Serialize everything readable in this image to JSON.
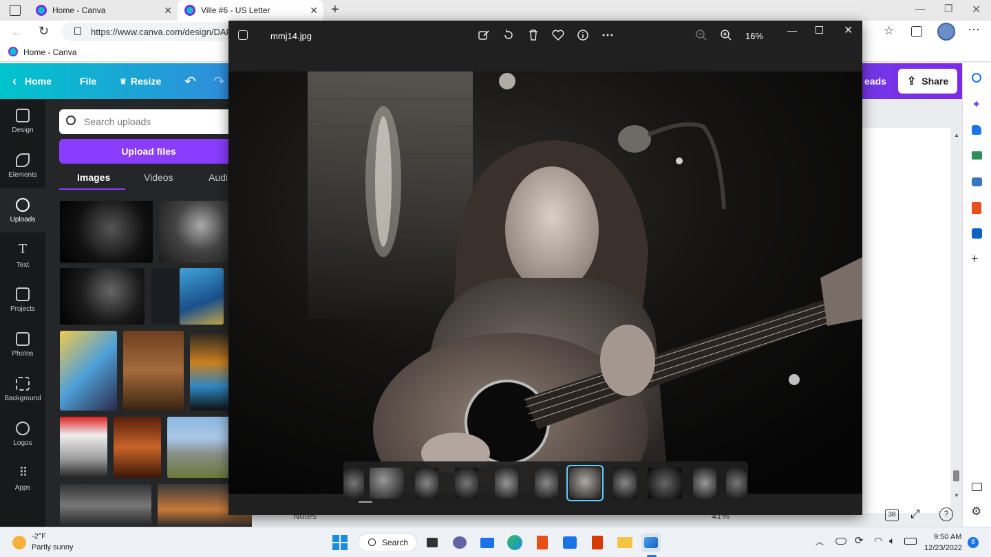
{
  "browser": {
    "tabs": [
      {
        "title": "Home - Canva"
      },
      {
        "title": "Ville #6 - US Letter"
      }
    ],
    "address": "https://www.canva.com/design/DAF",
    "favorites": [
      {
        "label": "Home - Canva"
      }
    ]
  },
  "canva": {
    "header": {
      "home": "Home",
      "file": "File",
      "resize": "Resize",
      "uploads_partial": "eads",
      "share": "Share"
    },
    "rail": [
      {
        "label": "Design",
        "icon": "design-icon"
      },
      {
        "label": "Elements",
        "icon": "elements-icon"
      },
      {
        "label": "Uploads",
        "icon": "uploads-icon"
      },
      {
        "label": "Text",
        "icon": "text-icon"
      },
      {
        "label": "Projects",
        "icon": "folder-icon"
      },
      {
        "label": "Photos",
        "icon": "photos-icon"
      },
      {
        "label": "Background",
        "icon": "background-icon"
      },
      {
        "label": "Logos",
        "icon": "logos-icon"
      },
      {
        "label": "Apps",
        "icon": "apps-icon"
      }
    ],
    "panel": {
      "search_placeholder": "Search uploads",
      "upload_button": "Upload files",
      "tabs": [
        "Images",
        "Videos",
        "Audi"
      ]
    },
    "bottom": {
      "notes": "Notes",
      "zoom": "41%",
      "page": "38"
    }
  },
  "viewer": {
    "filename": "mmj14.jpg",
    "zoom": "16%"
  },
  "taskbar": {
    "weather_temp": "-2°F",
    "weather_desc": "Partly sunny",
    "search": "Search",
    "time": "9:50 AM",
    "date": "12/23/2022",
    "notifications": "8"
  },
  "colors": {
    "canva_purple": "#8b3dff",
    "canva_teal": "#00c4cc",
    "viewer_bg": "#202020",
    "selection": "#60cdff"
  }
}
